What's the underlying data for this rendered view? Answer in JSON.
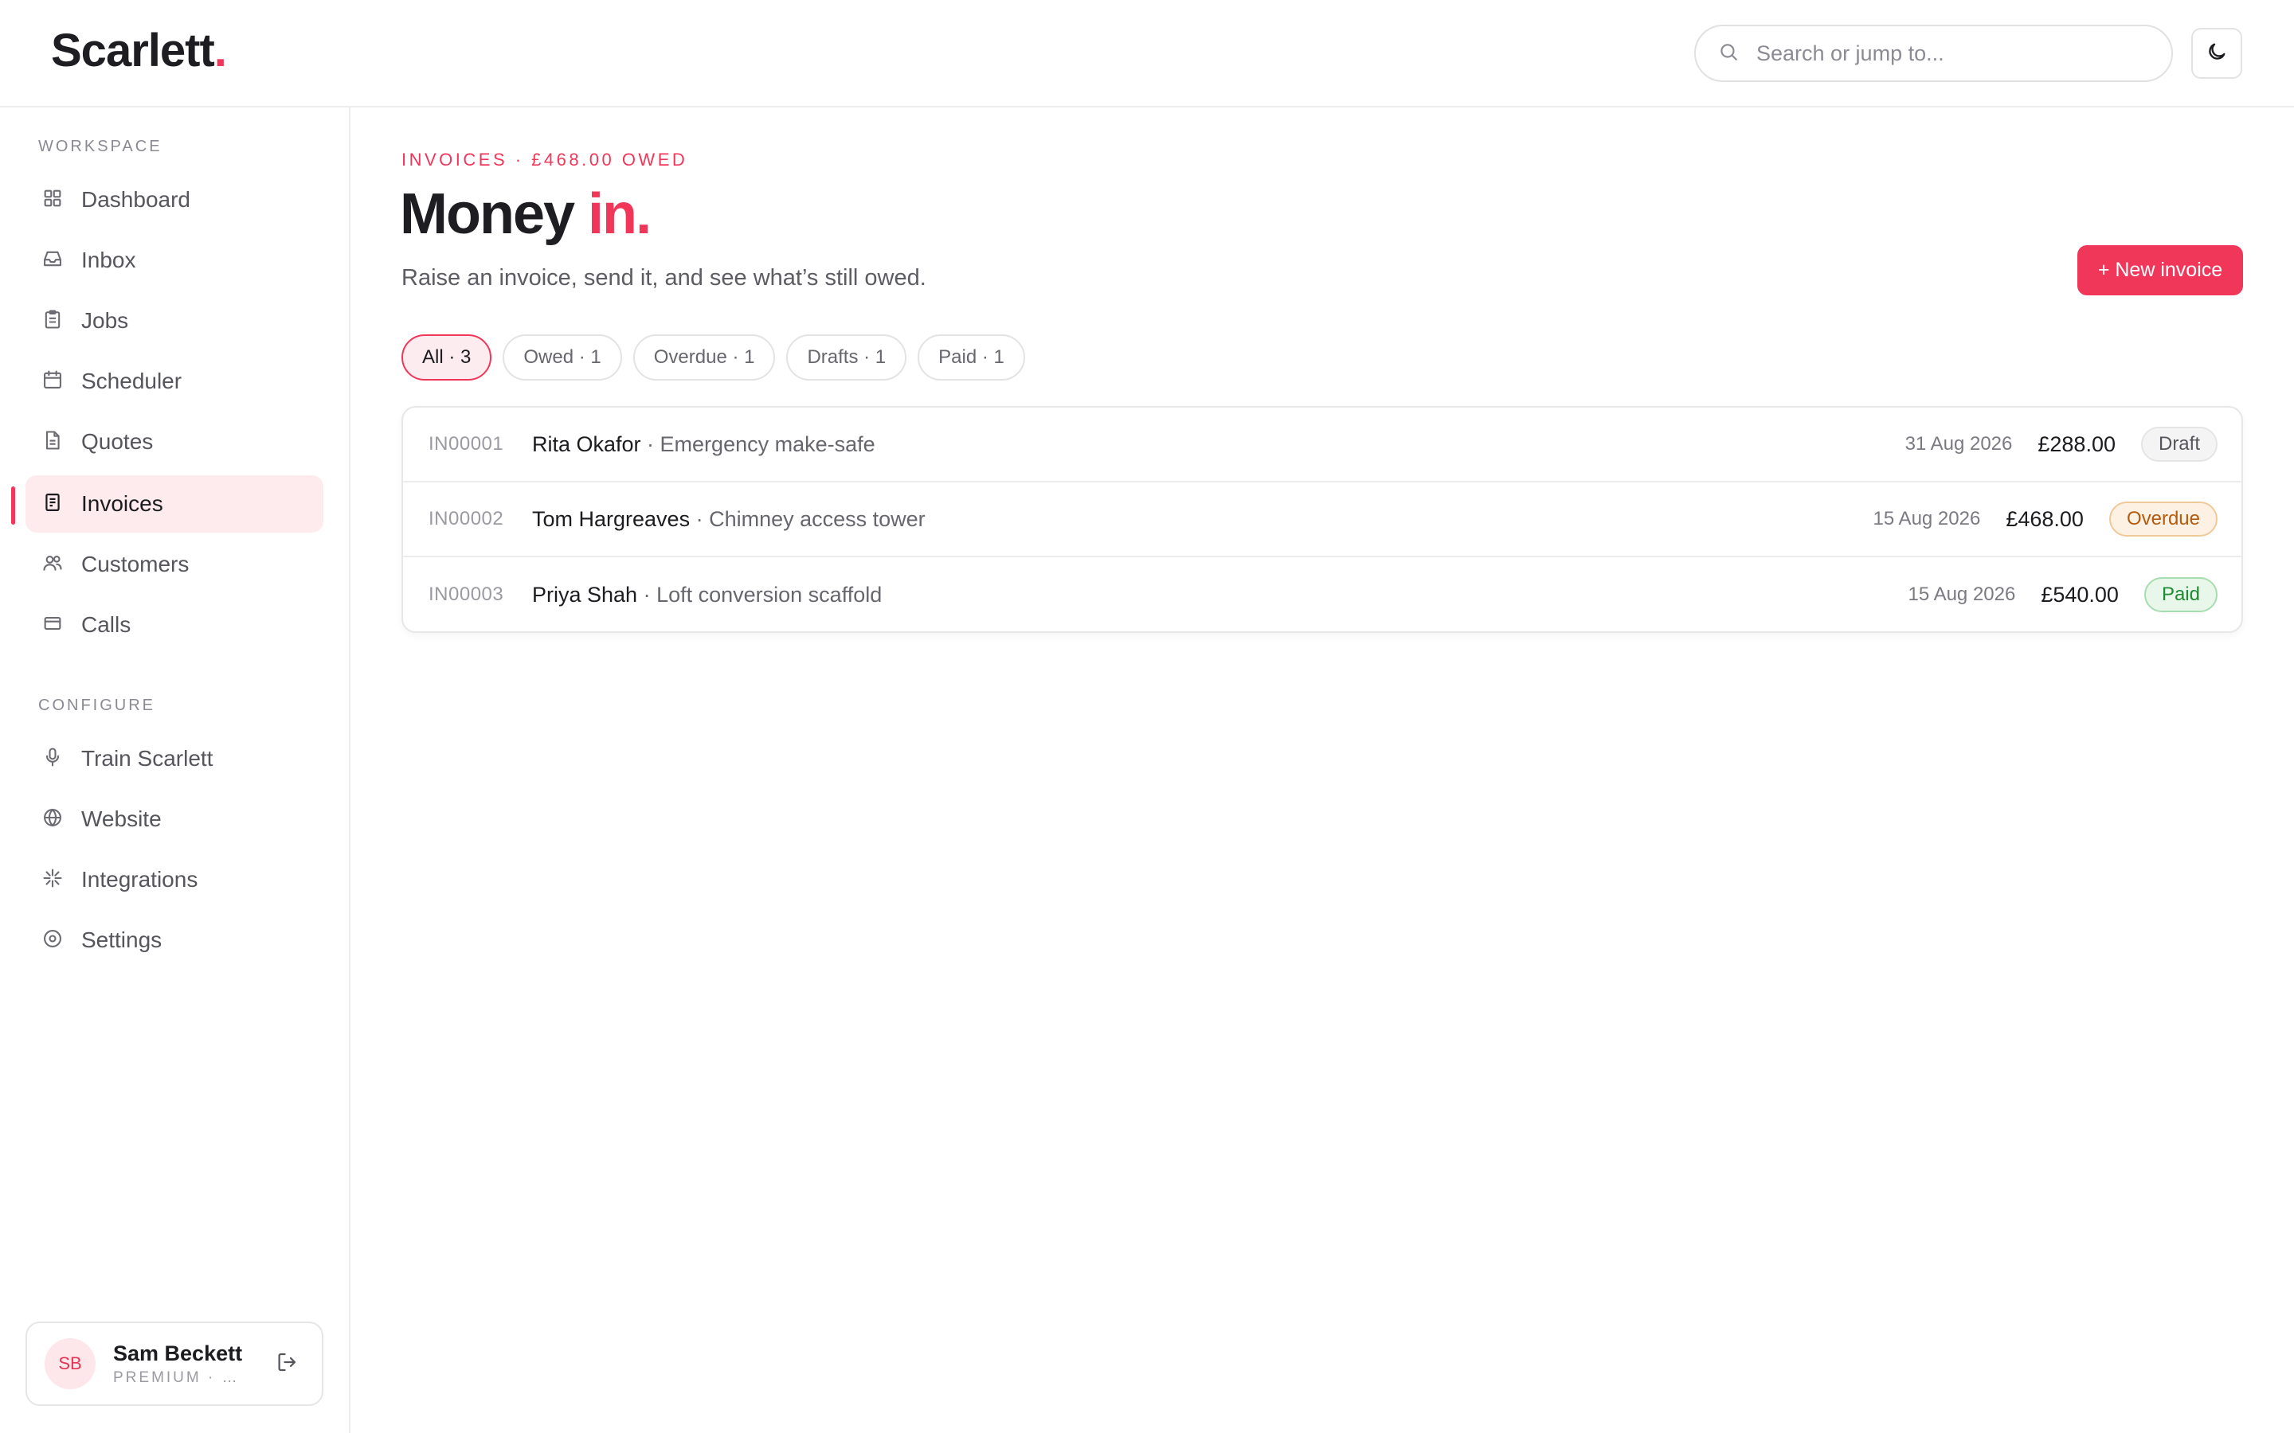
{
  "app": {
    "logo_text": "Scarlett",
    "logo_dot": ".",
    "accent_color": "#f0375a"
  },
  "header": {
    "search_placeholder": "Search or jump to..."
  },
  "sidebar": {
    "workspace_label": "WORKSPACE",
    "workspace_items": [
      {
        "label": "Dashboard",
        "icon": "grid-icon"
      },
      {
        "label": "Inbox",
        "icon": "inbox-icon"
      },
      {
        "label": "Jobs",
        "icon": "clipboard-icon"
      },
      {
        "label": "Scheduler",
        "icon": "calendar-icon"
      },
      {
        "label": "Quotes",
        "icon": "document-icon"
      },
      {
        "label": "Invoices",
        "icon": "receipt-icon",
        "active": true
      },
      {
        "label": "Customers",
        "icon": "users-icon"
      },
      {
        "label": "Calls",
        "icon": "card-icon"
      }
    ],
    "configure_label": "CONFIGURE",
    "configure_items": [
      {
        "label": "Train Scarlett",
        "icon": "microphone-icon"
      },
      {
        "label": "Website",
        "icon": "globe-icon"
      },
      {
        "label": "Integrations",
        "icon": "sparkle-icon"
      },
      {
        "label": "Settings",
        "icon": "settings-icon"
      }
    ],
    "user": {
      "initials": "SB",
      "name": "Sam Beckett",
      "plan": "PREMIUM · S..."
    }
  },
  "main": {
    "eyebrow": "INVOICES · £468.00 OWED",
    "title_main": "Money",
    "title_accent": "in.",
    "subtitle": "Raise an invoice, send it, and see what’s still owed.",
    "new_button": "+ New invoice",
    "filters": [
      {
        "label": "All · 3",
        "active": true
      },
      {
        "label": "Owed · 1"
      },
      {
        "label": "Overdue · 1"
      },
      {
        "label": "Drafts · 1"
      },
      {
        "label": "Paid · 1"
      }
    ],
    "invoices": [
      {
        "id": "IN00001",
        "customer": "Rita Okafor",
        "job": " · Emergency make-safe",
        "date": "31 Aug 2026",
        "amount": "£288.00",
        "status": "Draft"
      },
      {
        "id": "IN00002",
        "customer": "Tom Hargreaves",
        "job": " · Chimney access tower",
        "date": "15 Aug 2026",
        "amount": "£468.00",
        "status": "Overdue"
      },
      {
        "id": "IN00003",
        "customer": "Priya Shah",
        "job": " · Loft conversion scaffold",
        "date": "15 Aug 2026",
        "amount": "£540.00",
        "status": "Paid"
      }
    ]
  }
}
